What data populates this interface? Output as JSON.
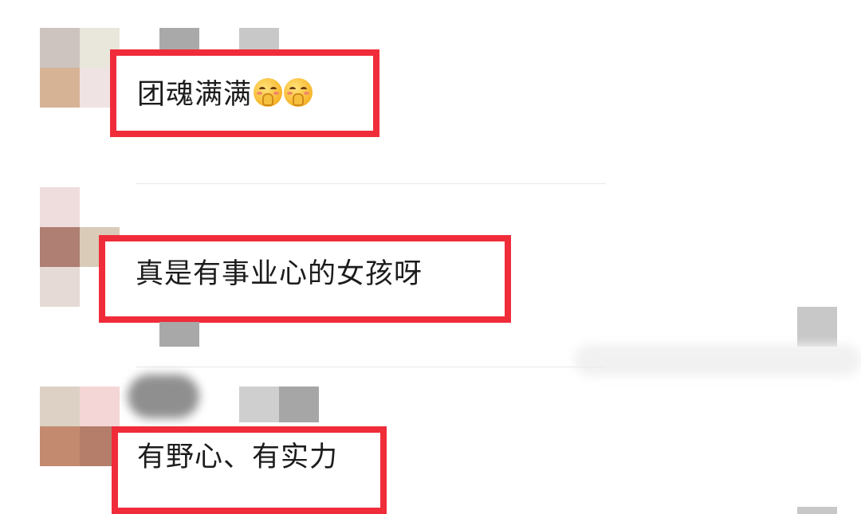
{
  "comments": [
    {
      "text": "团魂满满",
      "emoji": [
        "face-with-hand-over-mouth-icon",
        "face-with-hand-over-mouth-icon"
      ]
    },
    {
      "text": "真是有事业心的女孩呀"
    },
    {
      "text": "有野心、有实力"
    }
  ],
  "colors": {
    "highlight": "#f02c3a",
    "text": "#1c1c1c",
    "divider": "#e9e9e9"
  }
}
